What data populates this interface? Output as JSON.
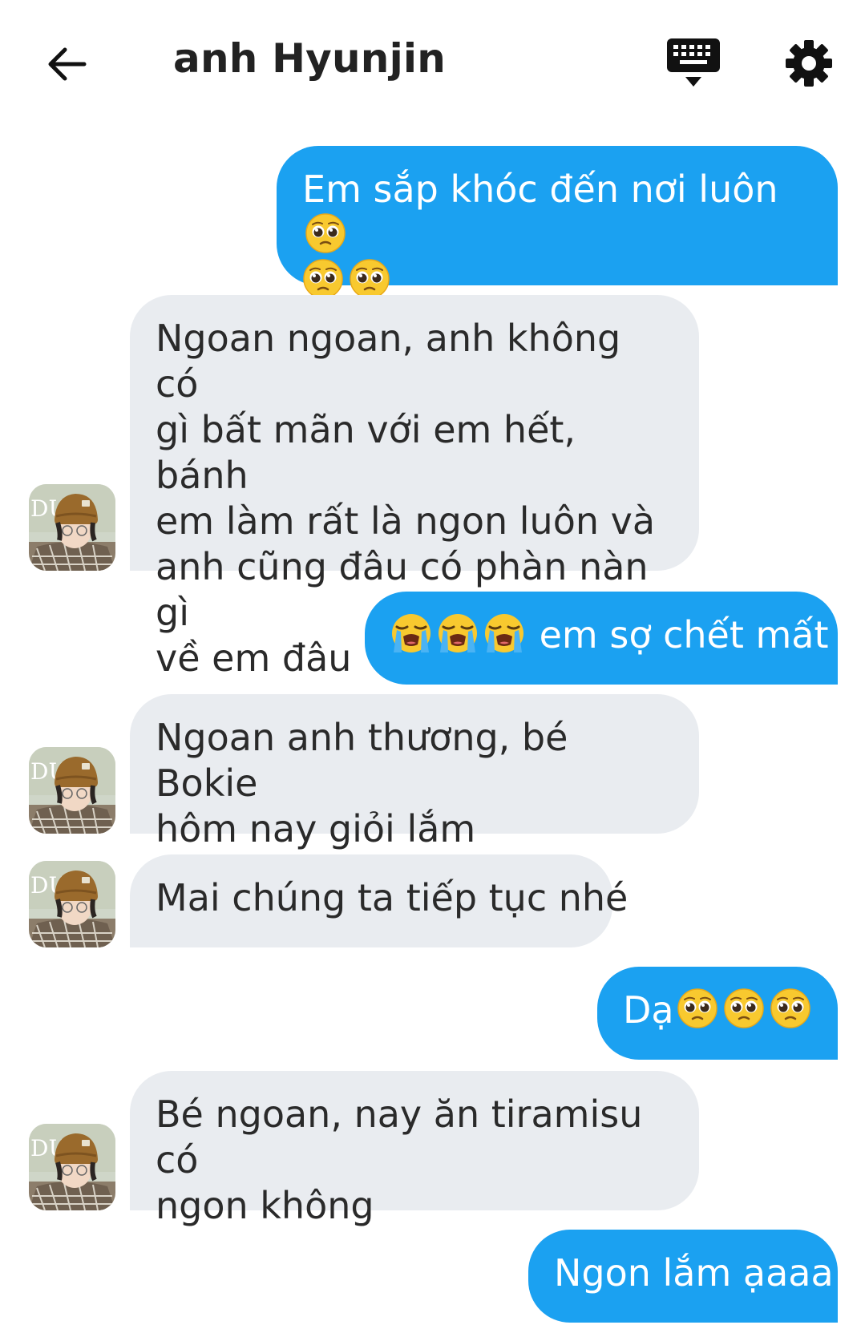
{
  "header": {
    "title": "anh Hyunjin",
    "back_icon": "arrow-left-icon",
    "keyboard_icon": "keyboard-icon",
    "settings_icon": "gear-icon"
  },
  "colors": {
    "outgoing_bubble": "#1ba1f1",
    "incoming_bubble": "#e9ecf0",
    "outgoing_text": "#ffffff",
    "incoming_text": "#2a2a2a"
  },
  "messages": [
    {
      "side": "out",
      "text": "Em sắp khóc đến nơi luôn",
      "emoji": "pleading-face x3"
    },
    {
      "side": "in",
      "text": "Ngoan ngoan, anh không có gì bất mãn với em hết, bánh em làm rất là ngon luôn và anh cũng đâu có phàn nàn gì về em đâu"
    },
    {
      "side": "out",
      "text": "em sợ chết mất",
      "emoji": "loudly-crying-face x3"
    },
    {
      "side": "in",
      "text": "Ngoan anh thương, bé Bokie hôm nay giỏi lắm"
    },
    {
      "side": "in",
      "text": "Mai chúng ta tiếp tục nhé"
    },
    {
      "side": "out",
      "text": "Dạ",
      "emoji": "pleading-face x3"
    },
    {
      "side": "in",
      "text": "Bé ngoan, nay ăn tiramisu có ngon không"
    },
    {
      "side": "out",
      "text": "Ngon lắm ạaaa"
    }
  ],
  "message_lines": {
    "m1_line1": "Em sắp khóc đến nơi luôn",
    "m2_line1": "Ngoan ngoan, anh không có",
    "m2_line2": "gì bất mãn với em hết, bánh",
    "m2_line3": "em làm rất là ngon luôn và",
    "m2_line4": "anh cũng đâu có phàn nàn gì",
    "m2_line5": "về em đâu",
    "m3_text": "em sợ chết mất",
    "m4_line1": "Ngoan anh thương, bé Bokie",
    "m4_line2": "hôm nay giỏi lắm",
    "m5_text": "Mai chúng ta tiếp tục nhé",
    "m6_text": "Dạ",
    "m7_line1": "Bé ngoan, nay ăn tiramisu có",
    "m7_line2": "ngon không",
    "m8_text": "Ngon lắm ạaaa"
  }
}
